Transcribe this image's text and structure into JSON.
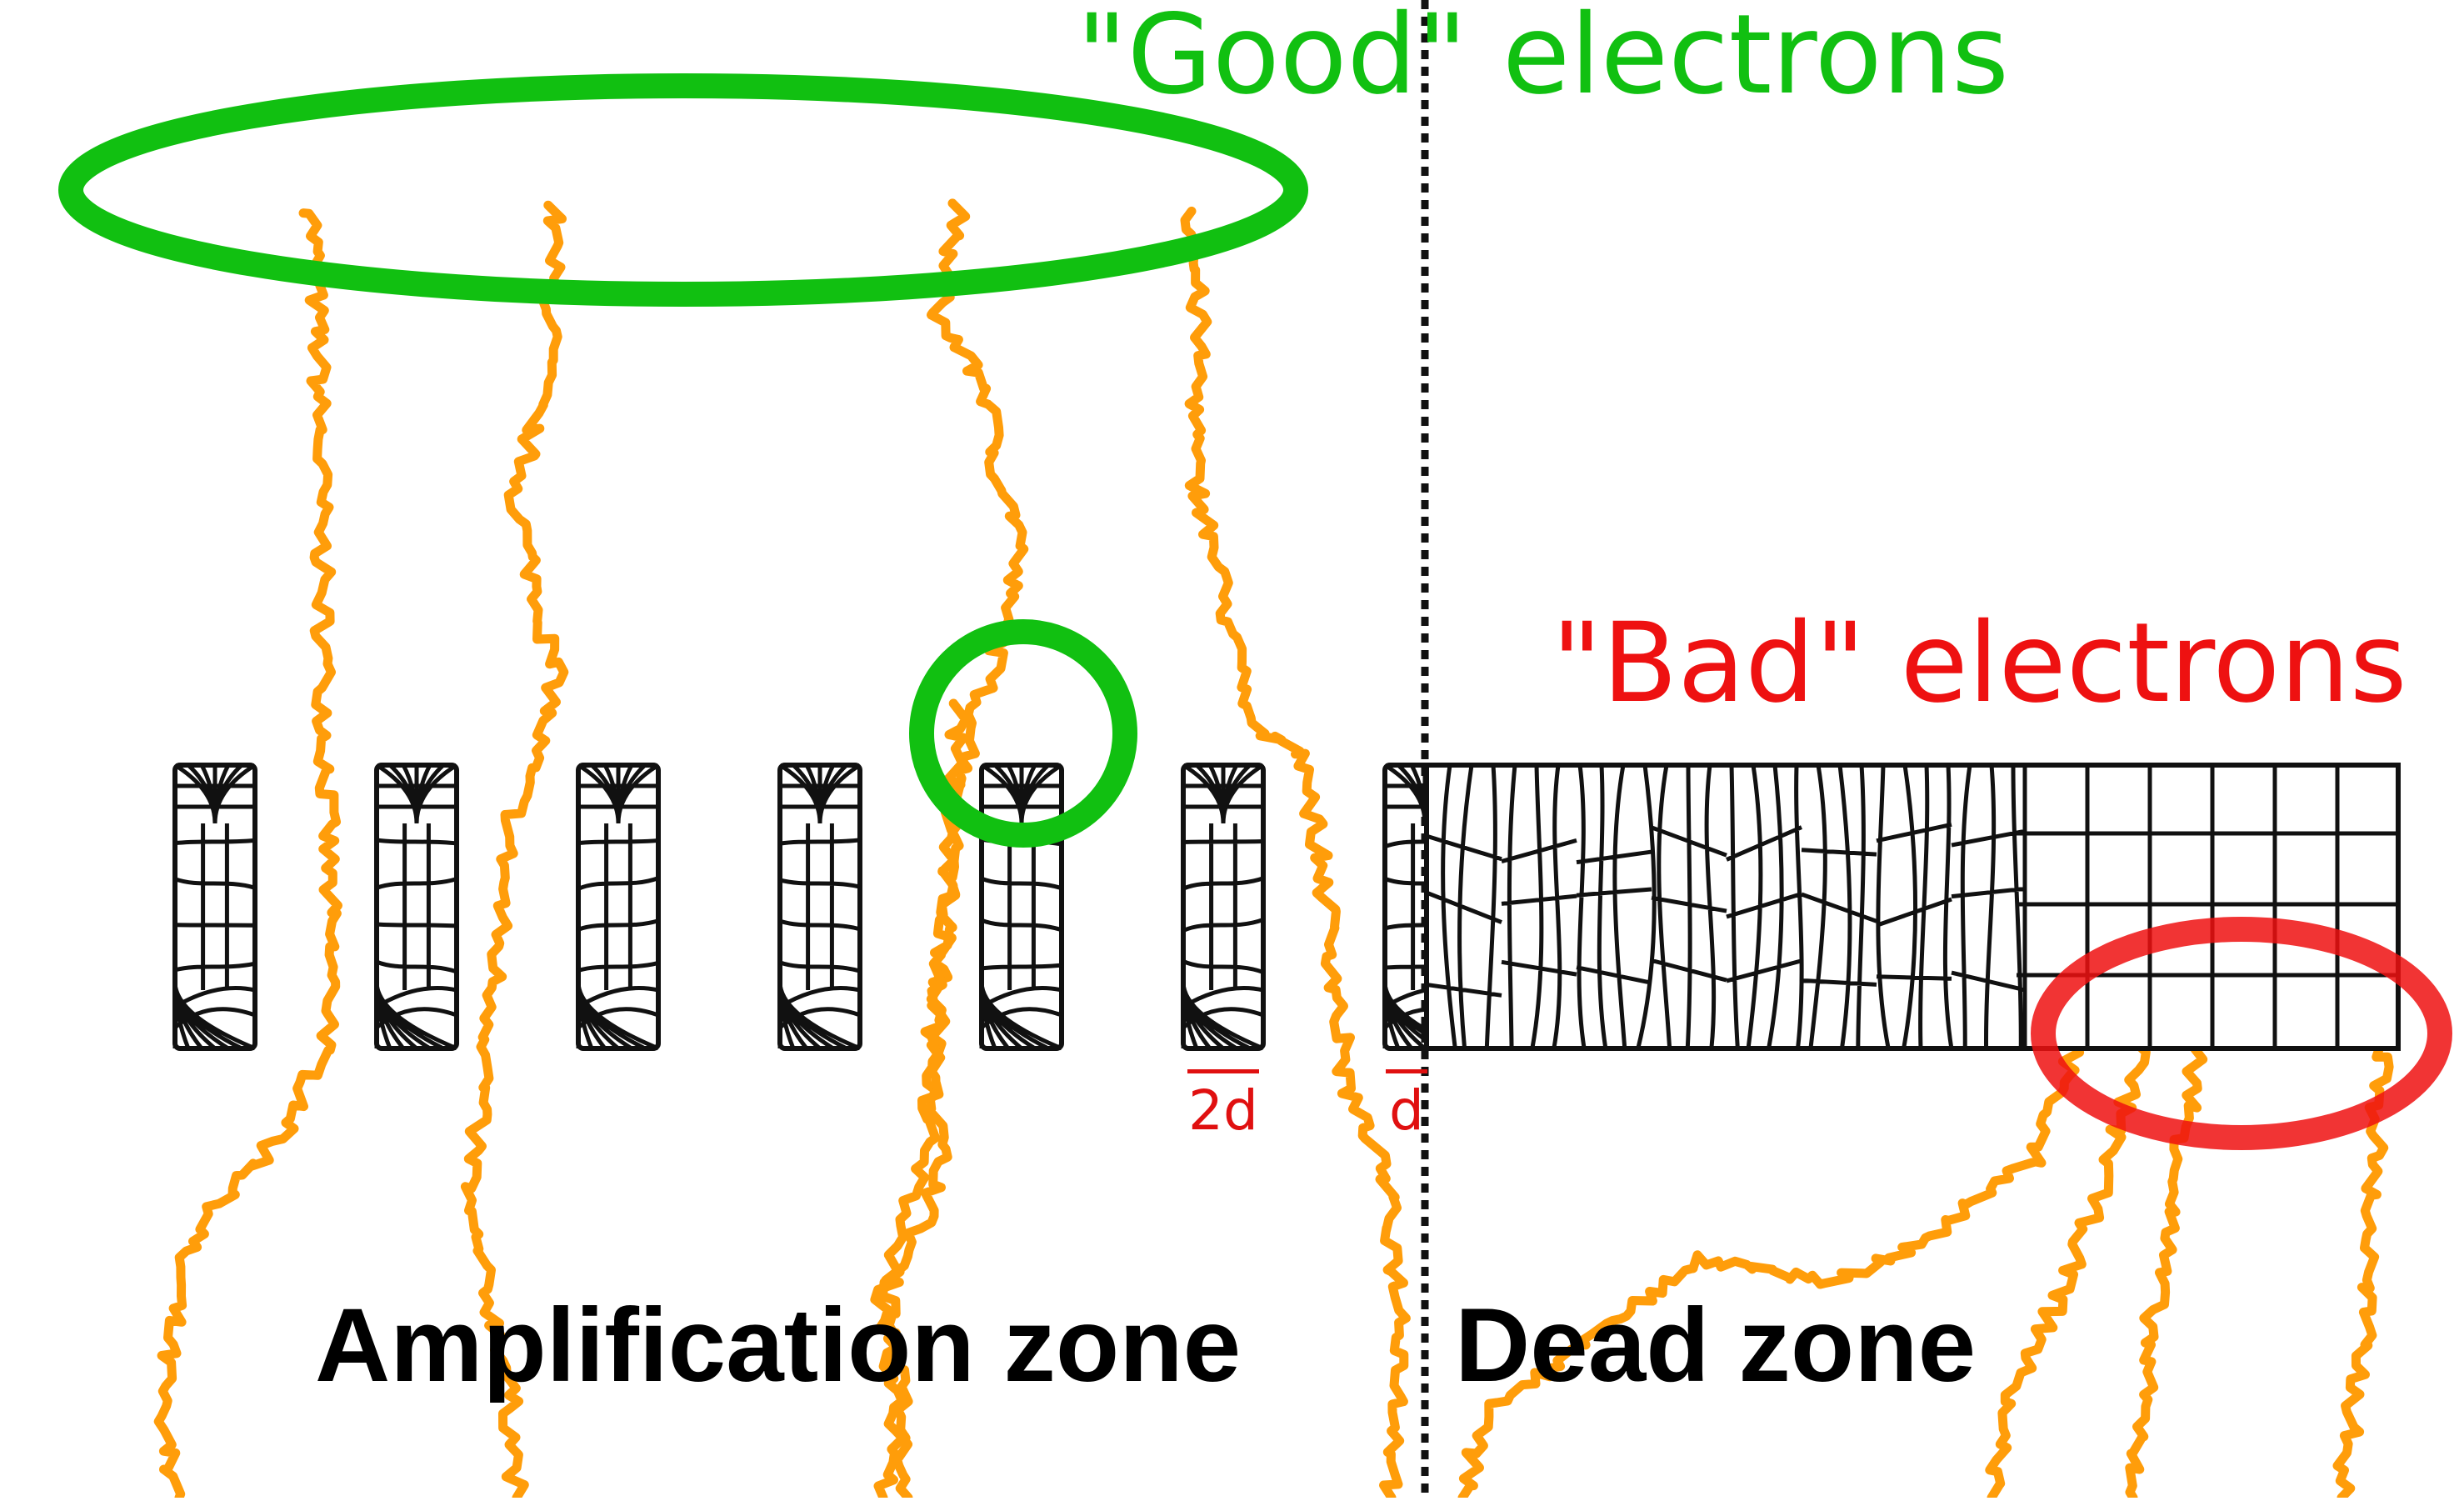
{
  "labels": {
    "good_electrons": "\"Good\" electrons",
    "bad_electrons": "\"Bad\" electrons",
    "amplification_zone": "Amplification zone",
    "dead_zone": "Dead zone",
    "pitch_2d": "2d",
    "pitch_d": "d"
  },
  "colors": {
    "good": "#11c011",
    "bad": "#ee1111",
    "electron_track": "#ff9d0a",
    "mesh": "#111111",
    "boundary": "#111111",
    "pitch_label": "#e01010"
  },
  "icons": {
    "good_region": "green-ellipse",
    "good_point": "green-circle",
    "bad_region": "red-ellipse",
    "boundary": "dotted-vertical-line"
  }
}
